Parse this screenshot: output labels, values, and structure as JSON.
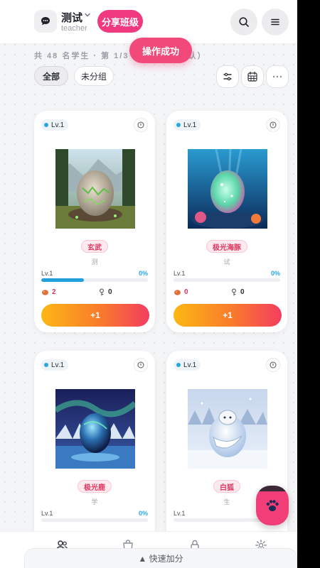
{
  "header": {
    "class_name": "测试",
    "role": "teacher",
    "share_button": "分享班级",
    "icons": [
      "chat-icon",
      "chevron-down-icon",
      "search-icon",
      "menu-icon"
    ]
  },
  "toast": "操作成功",
  "stats_line": "共 48 名学生 · 第 1/3        座位顺序（默认）",
  "filters": {
    "all": "全部",
    "ungrouped": "未分组"
  },
  "toolbar_icons": [
    "sliders-icon",
    "grid-icon",
    "more-icon"
  ],
  "cards": [
    {
      "level": "Lv.1",
      "pet_name": "玄武",
      "student": "测",
      "level_label": "Lv.1",
      "progress_text": "0%",
      "progress": 0.0,
      "food": "2",
      "keys": "0",
      "plus": "+1"
    },
    {
      "level": "Lv.1",
      "pet_name": "极光海豚",
      "student": "试",
      "level_label": "Lv.1",
      "progress_text": "0%",
      "progress": 0.0,
      "food": "0",
      "keys": "0",
      "plus": "+1"
    },
    {
      "level": "Lv.1",
      "pet_name": "极光鹿",
      "student": "学",
      "level_label": "Lv.1",
      "progress_text": "0%",
      "progress": 0.0,
      "food": "",
      "keys": "",
      "plus": ""
    },
    {
      "level": "Lv.1",
      "pet_name": "白狐",
      "student": "生",
      "level_label": "Lv.1",
      "progress_text": "0%",
      "progress": 0.0,
      "food": "",
      "keys": "",
      "plus": ""
    }
  ],
  "bottom_nav": [
    "students-icon",
    "shop-icon",
    "lock-icon",
    "settings-icon"
  ],
  "quick_bar": "▲ 快速加分",
  "colors": {
    "accent_pink": "#f0397f",
    "progress_blue": "#22a0dc",
    "button_gradient_start": "#fdb714",
    "button_gradient_end": "#f43d5f"
  }
}
